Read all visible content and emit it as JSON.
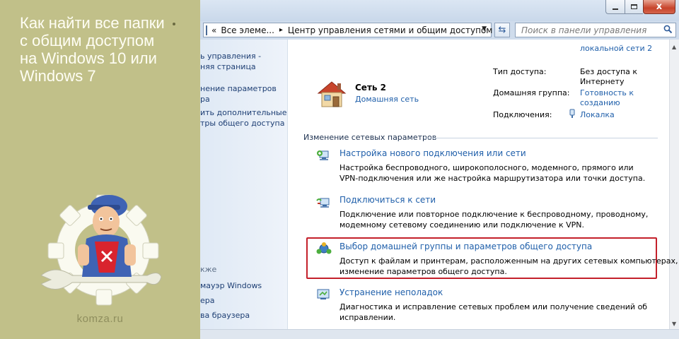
{
  "banner": {
    "headline_lines": [
      "Как найти все папки",
      "с общим доступом",
      "на Windows 10 или",
      "Windows 7"
    ],
    "site": "komza.ru"
  },
  "window": {
    "controls": {
      "minimize": "",
      "maximize": "",
      "close": "x"
    },
    "address": {
      "crumbs": [
        "Все элеме...",
        "Центр управления сетями и общим доступом"
      ]
    },
    "search": {
      "placeholder": "Поиск в панели управления"
    }
  },
  "sidebar": {
    "items": [
      "ь управления -",
      "няя страница",
      "нение параметров",
      "ра",
      "ить дополнительные",
      "тры общего доступа",
      "кже",
      "мауэр Windows",
      "ера",
      "ва браузера"
    ]
  },
  "network": {
    "top_link_partial": "локальной сети 2",
    "name": "Сеть  2",
    "type_link": "Домашняя сеть",
    "props": {
      "access_label": "Тип доступа:",
      "access_value": [
        "Без доступа к",
        "Интернету"
      ],
      "homegroup_label": "Домашняя группа:",
      "homegroup_value": [
        "Готовность к",
        "созданию"
      ],
      "connections_label": "Подключения:",
      "connections_value": "Локалка"
    }
  },
  "section": {
    "header": "Изменение сетевых параметров",
    "tasks": [
      {
        "title": "Настройка нового подключения или сети",
        "desc": [
          "Настройка беспроводного, широкополосного, модемного, прямого или",
          "VPN-подключения или же настройка маршрутизатора или точки доступа."
        ]
      },
      {
        "title": "Подключиться к сети",
        "desc": [
          "Подключение или повторное подключение к беспроводному, проводному,",
          "модемному сетевому соединению или подключение к VPN."
        ]
      },
      {
        "title": "Выбор домашней группы и параметров общего доступа",
        "desc": [
          "Доступ к файлам и принтерам, расположенным на других сетевых компьютерах, или",
          "изменение параметров общего доступа."
        ]
      },
      {
        "title": "Устранение неполадок",
        "desc": [
          "Диагностика и исправление сетевых проблем или получение сведений об",
          "исправлении."
        ]
      }
    ]
  },
  "colors": {
    "banner": "#c1c089",
    "link": "#1f5faa",
    "highlight": "#c4202b"
  }
}
